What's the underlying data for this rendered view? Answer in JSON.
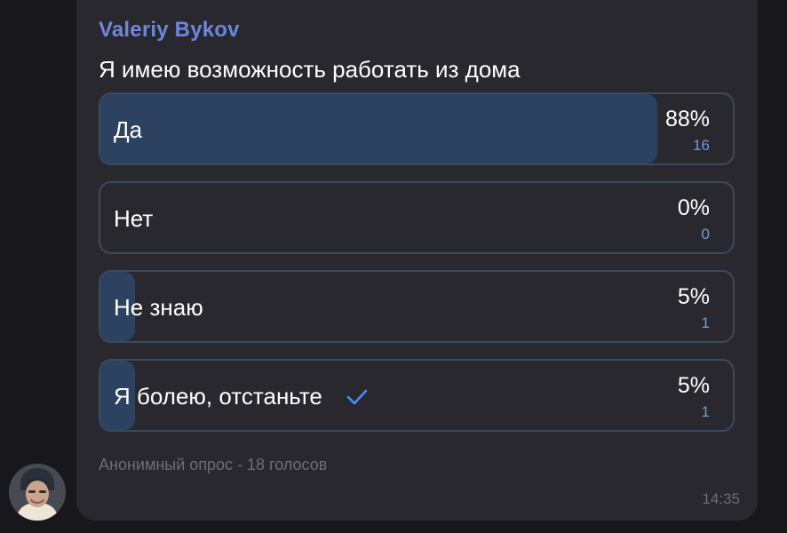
{
  "message": {
    "sender": "Valeriy Bykov",
    "time": "14:35"
  },
  "poll": {
    "question": "Я имею возможность работать из дома",
    "footer": "Анонимный опрос - 18 голосов",
    "options": [
      {
        "label": "Да",
        "percent": "88%",
        "votes": "16",
        "fill_fraction": 0.88,
        "selected": false
      },
      {
        "label": "Нет",
        "percent": "0%",
        "votes": "0",
        "fill_fraction": 0.0,
        "selected": false
      },
      {
        "label": "Не знаю",
        "percent": "5%",
        "votes": "1",
        "fill_fraction": 0.055,
        "selected": false
      },
      {
        "label": "Я болею, отстаньте",
        "percent": "5%",
        "votes": "1",
        "fill_fraction": 0.055,
        "selected": true
      }
    ]
  },
  "colors": {
    "accent_name": "#6f86de",
    "fill": "#2c4260",
    "check": "#4a8ff5"
  },
  "icons": {
    "selected_mark": "checkmark-icon",
    "avatar": "user-avatar"
  }
}
